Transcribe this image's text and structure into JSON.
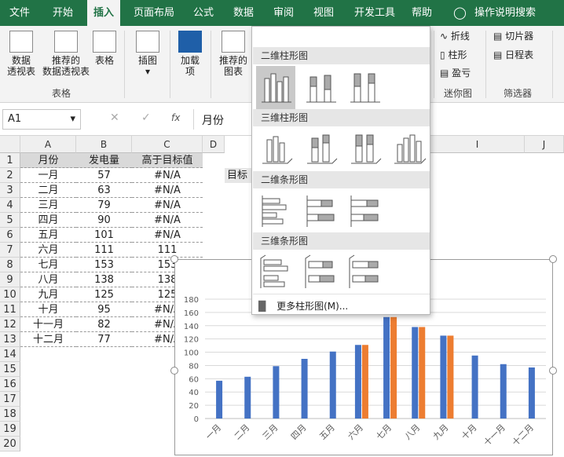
{
  "tabs": [
    "文件",
    "开始",
    "插入",
    "页面布局",
    "公式",
    "数据",
    "审阅",
    "视图",
    "开发工具",
    "帮助",
    "操作说明搜索"
  ],
  "ribbon": {
    "pivot_label_1": "数据",
    "pivot_label_2": "透视表",
    "rec_pivot_1": "推荐的",
    "rec_pivot_2": "数据透视表",
    "table": "表格",
    "group_tables": "表格",
    "illustrations": "插图",
    "addins_1": "加载",
    "addins_2": "项",
    "rec_chart_1": "推荐的",
    "rec_chart_2": "图表",
    "spark_line": "折线",
    "spark_column": "柱形",
    "spark_winloss": "盈亏",
    "group_sparklines": "迷你图",
    "slicer": "切片器",
    "timeline": "日程表",
    "group_filters": "筛选器"
  },
  "formula_bar": {
    "name_box": "A1",
    "content": "月份",
    "fx": "fx"
  },
  "sheet": {
    "columns": [
      "A",
      "B",
      "C",
      "D",
      "I",
      "J"
    ],
    "rows": [
      "1",
      "2",
      "3",
      "4",
      "5",
      "6",
      "7",
      "8",
      "9",
      "10",
      "11",
      "12",
      "13",
      "14",
      "15",
      "16",
      "17",
      "18",
      "19",
      "20"
    ],
    "headers": [
      "月份",
      "发电量",
      "高于目标值"
    ],
    "data": [
      [
        "一月",
        "57",
        "#N/A"
      ],
      [
        "二月",
        "63",
        "#N/A"
      ],
      [
        "三月",
        "79",
        "#N/A"
      ],
      [
        "四月",
        "90",
        "#N/A"
      ],
      [
        "五月",
        "101",
        "#N/A"
      ],
      [
        "六月",
        "111",
        "111"
      ],
      [
        "七月",
        "153",
        "153"
      ],
      [
        "八月",
        "138",
        "138"
      ],
      [
        "九月",
        "125",
        "125"
      ],
      [
        "十月",
        "95",
        "#N/A"
      ],
      [
        "十一月",
        "82",
        "#N/A"
      ],
      [
        "十二月",
        "77",
        "#N/A"
      ]
    ],
    "d2_text": "目标"
  },
  "dropdown": {
    "sec_2d_col": "二维柱形图",
    "sec_3d_col": "三维柱形图",
    "sec_2d_bar": "二维条形图",
    "sec_3d_bar": "三维条形图",
    "more": "更多柱形图(M)..."
  },
  "chart_data": {
    "type": "bar",
    "categories": [
      "一月",
      "二月",
      "三月",
      "四月",
      "五月",
      "六月",
      "七月",
      "八月",
      "九月",
      "十月",
      "十一月",
      "十二月"
    ],
    "series": [
      {
        "values": [
          57,
          63,
          79,
          90,
          101,
          111,
          153,
          138,
          125,
          95,
          82,
          77
        ],
        "color": "#4472c4"
      },
      {
        "values": [
          null,
          null,
          null,
          null,
          null,
          111,
          153,
          138,
          125,
          null,
          null,
          null
        ],
        "color": "#ed7d31"
      }
    ],
    "ylim": [
      0,
      180
    ],
    "yticks": [
      "0",
      "20",
      "40",
      "60",
      "80",
      "100",
      "120",
      "140",
      "160",
      "180"
    ]
  }
}
